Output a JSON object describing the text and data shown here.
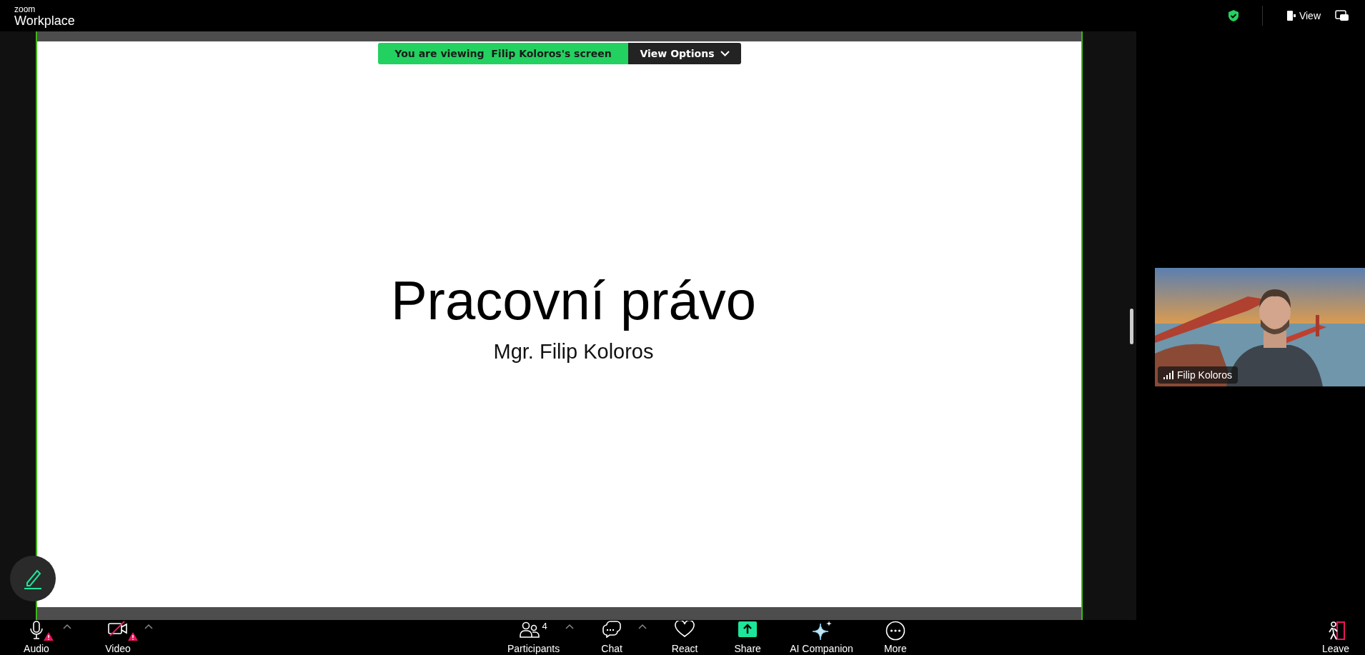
{
  "app": {
    "logo_small": "zoom",
    "logo_large": "Workplace"
  },
  "top_right": {
    "secure": true,
    "view_button": "View"
  },
  "banner": {
    "message": "You are viewing  Filip Koloros's screen",
    "options_button": "View Options"
  },
  "slide": {
    "title": "Pracovní právo",
    "subtitle": "Mgr. Filip Koloros"
  },
  "participant_video": {
    "name": "Filip Koloros"
  },
  "toolbar": {
    "left": [
      {
        "label": "Audio",
        "kind": "audio",
        "warning": true,
        "menu_caret": true
      },
      {
        "label": "Video",
        "kind": "video",
        "warning": true,
        "menu_caret": true
      }
    ],
    "center": [
      {
        "label": "Participants",
        "kind": "participants",
        "count": "4",
        "menu_caret": true
      },
      {
        "label": "Chat",
        "kind": "chat",
        "menu_caret": true
      },
      {
        "label": "React",
        "kind": "react",
        "menu_caret": false
      },
      {
        "label": "Share",
        "kind": "share",
        "menu_caret": false
      },
      {
        "label": "AI Companion",
        "kind": "ai",
        "menu_caret": false
      },
      {
        "label": "More",
        "kind": "more",
        "menu_caret": false
      }
    ],
    "leave": "Leave"
  }
}
